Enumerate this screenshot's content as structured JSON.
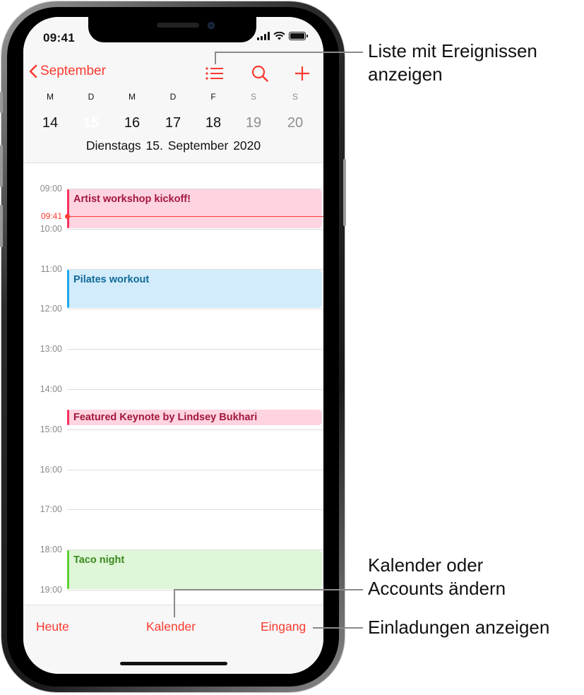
{
  "status_bar": {
    "time": "09:41",
    "icons": [
      "signal-icon",
      "wifi-icon",
      "battery-icon"
    ]
  },
  "nav": {
    "back_label": "September",
    "back_icon": "chevron-left-icon",
    "list_icon": "list-icon",
    "search_icon": "search-icon",
    "add_icon": "plus-icon"
  },
  "week": {
    "days": [
      {
        "dow": "M",
        "date": "14",
        "weekend": false,
        "selected": false
      },
      {
        "dow": "D",
        "date": "15",
        "weekend": false,
        "selected": true
      },
      {
        "dow": "M",
        "date": "16",
        "weekend": false,
        "selected": false
      },
      {
        "dow": "D",
        "date": "17",
        "weekend": false,
        "selected": false
      },
      {
        "dow": "F",
        "date": "18",
        "weekend": false,
        "selected": false
      },
      {
        "dow": "S",
        "date": "19",
        "weekend": true,
        "selected": false
      },
      {
        "dow": "S",
        "date": "20",
        "weekend": true,
        "selected": false
      }
    ],
    "full_date": "Dienstags  15. September 2020"
  },
  "timeline": {
    "hours": [
      "09:00",
      "10:00",
      "11:00",
      "12:00",
      "13:00",
      "14:00",
      "15:00",
      "16:00",
      "17:00",
      "18:00",
      "19:00"
    ],
    "now_label": "09:41",
    "events": [
      {
        "title": "Artist workshop kickoff!",
        "start": "09:00",
        "end": "10:00",
        "bg": "#fdd4df",
        "bar": "#f7305e",
        "fg": "#a3173e"
      },
      {
        "title": "Pilates workout",
        "start": "11:00",
        "end": "12:00",
        "bg": "#d2ecfb",
        "bar": "#1aa7ee",
        "fg": "#126a97"
      },
      {
        "title": "Featured Keynote by Lindsey Bukhari",
        "start": "14:30",
        "end": "14:55",
        "bg": "#fdd4df",
        "bar": "#f7305e",
        "fg": "#a3173e"
      },
      {
        "title": "Taco night",
        "start": "18:00",
        "end": "19:00",
        "bg": "#dff6d8",
        "bar": "#5cd135",
        "fg": "#3a8a1e"
      }
    ]
  },
  "tabbar": {
    "today": "Heute",
    "calendars": "Kalender",
    "inbox": "Eingang"
  },
  "callouts": {
    "list": [
      "Liste mit Ereignissen",
      "anzeigen"
    ],
    "calendars": [
      "Kalender oder",
      "Accounts ändern"
    ],
    "inbox": "Einladungen anzeigen"
  },
  "colors": {
    "accent": "#fa3b30",
    "weekend": "#8e8e93",
    "callout_line": "#8a8a8a"
  }
}
